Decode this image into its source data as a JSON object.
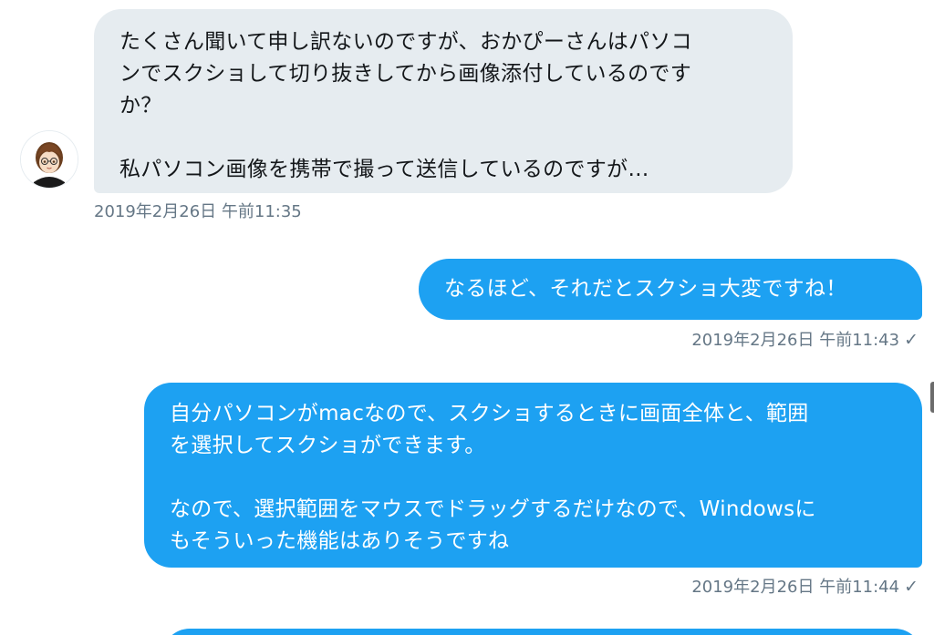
{
  "conversation": {
    "incoming_message": {
      "lines": [
        "たくさん聞いて申し訳ないのですが、おかぴーさんはパソコ",
        "ンでスクショして切り抜きしてから画像添付しているのです",
        "か？",
        "私パソコン画像を携帯で撮って送信しているのですが…"
      ],
      "timestamp": "2019年2月26日 午前11:35",
      "avatar_icon": "user-avatar-icon"
    },
    "outgoing_message_1": {
      "lines": [
        "なるほど、それだとスクショ大変ですね！"
      ],
      "timestamp": "2019年2月26日 午前11:43",
      "status": "✓"
    },
    "outgoing_message_2": {
      "lines": [
        "自分パソコンがmacなので、スクショするときに画面全体と、範囲",
        "を選択してスクショができます。",
        "なので、選択範囲をマウスでドラッグするだけなので、Windowsに",
        "もそういった機能はありそうですね"
      ],
      "timestamp": "2019年2月26日 午前11:44",
      "status": "✓"
    },
    "colors": {
      "incoming_bubble": "#e6ecf0",
      "outgoing_bubble": "#1da1f2",
      "timestamp_text": "#657786"
    }
  }
}
